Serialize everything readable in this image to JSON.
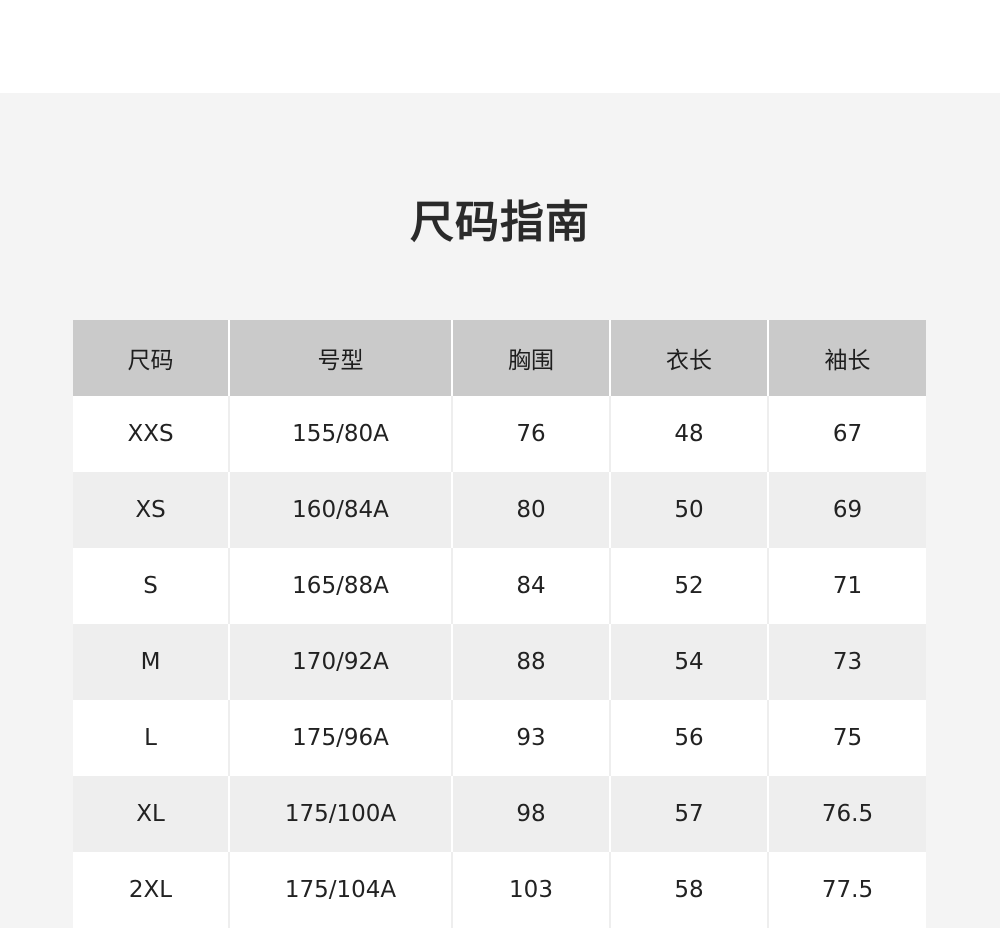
{
  "title": "尺码指南",
  "table": {
    "headers": [
      "尺码",
      "号型",
      "胸围",
      "衣长",
      "袖长"
    ],
    "rows": [
      [
        "XXS",
        "155/80A",
        "76",
        "48",
        "67"
      ],
      [
        "XS",
        "160/84A",
        "80",
        "50",
        "69"
      ],
      [
        "S",
        "165/88A",
        "84",
        "52",
        "71"
      ],
      [
        "M",
        "170/92A",
        "88",
        "54",
        "73"
      ],
      [
        "L",
        "175/96A",
        "93",
        "56",
        "75"
      ],
      [
        "XL",
        "175/100A",
        "98",
        "57",
        "76.5"
      ],
      [
        "2XL",
        "175/104A",
        "103",
        "58",
        "77.5"
      ]
    ]
  },
  "colors": {
    "header_bg": "#cacaca",
    "stripe_bg": "#eeeeee",
    "panel_bg": "#f4f4f4"
  }
}
